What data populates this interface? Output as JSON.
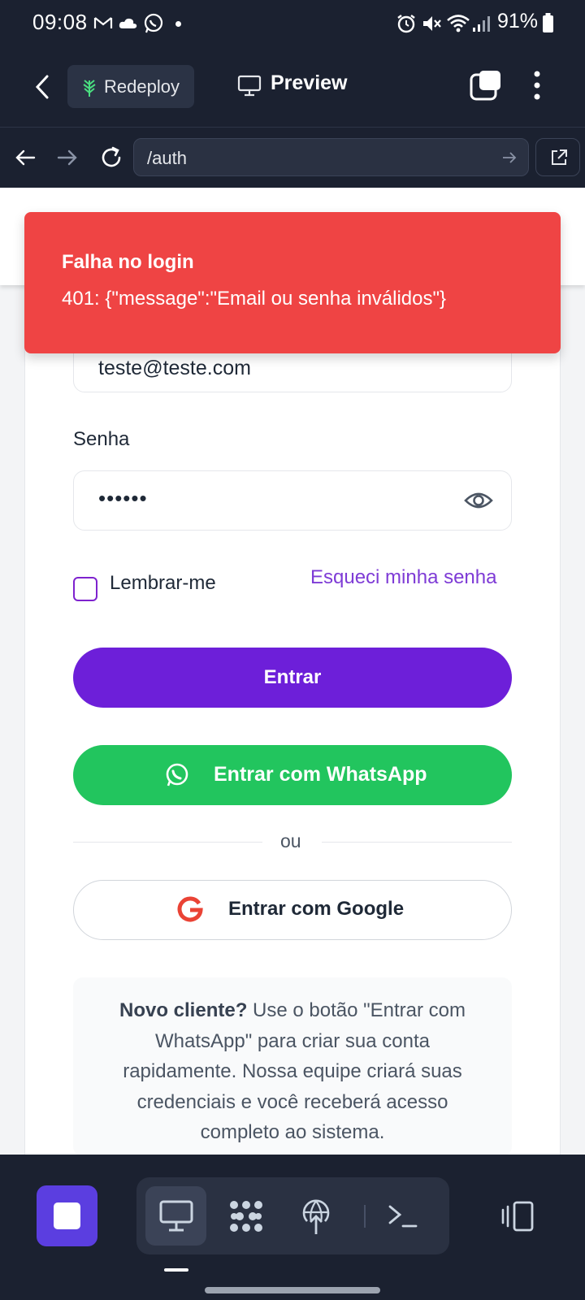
{
  "status_bar": {
    "time": "09:08",
    "battery": "91%"
  },
  "header": {
    "redeploy_label": "Redeploy",
    "preview_label": "Preview"
  },
  "url_bar": {
    "url": "/auth"
  },
  "form": {
    "email_value": "teste@teste.com",
    "password_label": "Senha",
    "password_value": "••••••",
    "remember_label": "Lembrar-me",
    "forgot_link": "Esqueci minha senha",
    "login_button": "Entrar",
    "whatsapp_button": "Entrar com WhatsApp",
    "divider_text": "ou",
    "google_button": "Entrar com Google",
    "info_bold": "Novo cliente?",
    "info_text": " Use o botão \"Entrar com WhatsApp\" para criar sua conta rapidamente. Nossa equipe criará suas credenciais e você receberá acesso completo ao sistema."
  },
  "toast": {
    "title": "Falha no login",
    "message": "401: {\"message\":\"Email ou senha inválidos\"}"
  },
  "colors": {
    "primary": "#6d1fd9",
    "whatsapp": "#22c55e",
    "error": "#ef4444",
    "chrome": "#1b2130"
  }
}
